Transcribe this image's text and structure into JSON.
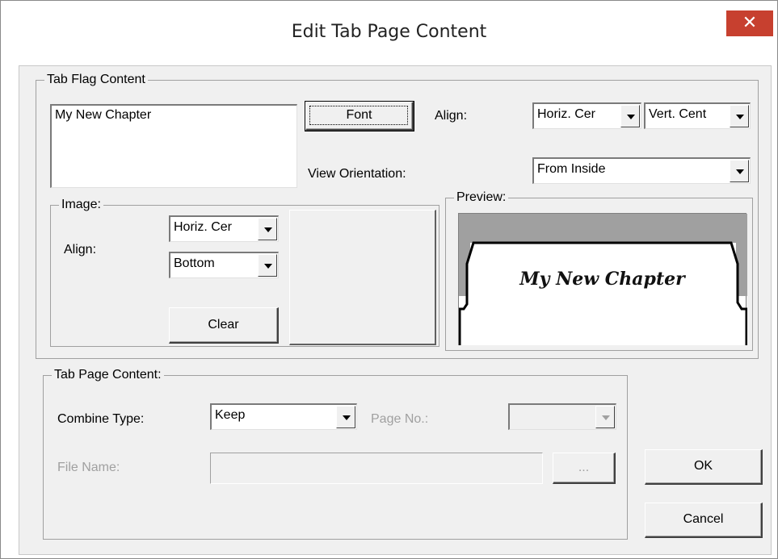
{
  "window": {
    "title": "Edit Tab Page Content",
    "close_glyph": "✕"
  },
  "tab_flag": {
    "legend": "Tab Flag Content",
    "text_value": "My New Chapter",
    "font_button": "Font",
    "align_label": "Align:",
    "align_horiz": "Horiz. Cer",
    "align_vert": "Vert. Cent",
    "view_orientation_label": "View Orientation:",
    "view_orientation_value": "From Inside"
  },
  "image": {
    "legend": "Image:",
    "align_label": "Align:",
    "align_horiz": "Horiz. Cer",
    "align_vert": "Bottom",
    "clear_button": "Clear"
  },
  "preview": {
    "legend": "Preview:",
    "tab_text": "My New Chapter"
  },
  "tab_page": {
    "legend": "Tab Page Content:",
    "combine_label": "Combine Type:",
    "combine_value": "Keep",
    "page_no_label": "Page No.:",
    "page_no_value": "",
    "file_name_label": "File Name:",
    "file_name_value": "",
    "browse_button": "..."
  },
  "buttons": {
    "ok": "OK",
    "cancel": "Cancel"
  },
  "colors": {
    "close_button": "#c7402f",
    "dialog_bg": "#f0f0f0",
    "preview_band": "#a0a0a0"
  }
}
